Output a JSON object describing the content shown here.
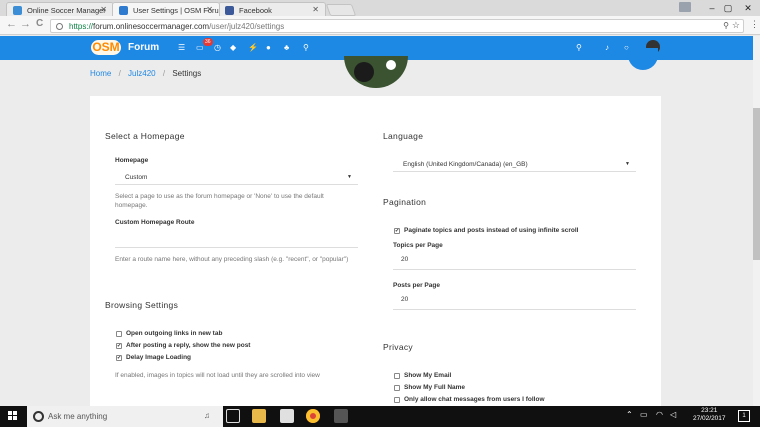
{
  "browser": {
    "tabs": [
      {
        "title": "Online Soccer Manager",
        "active": false
      },
      {
        "title": "User Settings | OSM Foru",
        "active": true
      },
      {
        "title": "Facebook",
        "active": false
      }
    ],
    "url_scheme": "https://",
    "url_host": "forum.onlinesoccermanager.com",
    "url_path": "/user/julz420/settings",
    "window_controls": {
      "minimize": "–",
      "maximize": "▢",
      "close": "✕"
    },
    "nav": {
      "back": "←",
      "forward": "→",
      "reload": "C"
    }
  },
  "site": {
    "logo": "OSM",
    "forum_label": "Forum",
    "notification_count": "36",
    "accent": "#1e88e5"
  },
  "breadcrumb": {
    "home": "Home",
    "user": "Julz420",
    "current": "Settings"
  },
  "left": {
    "homepage_section": "Select a Homepage",
    "homepage_label": "Homepage",
    "homepage_value": "Custom",
    "homepage_help": "Select a page to use as the forum homepage or 'None' to use the default homepage.",
    "route_label": "Custom Homepage Route",
    "route_value": "",
    "route_help": "Enter a route name here, without any preceding slash (e.g. \"recent\", or \"popular\")",
    "browsing_section": "Browsing Settings",
    "browsing_options": [
      {
        "label": "Open outgoing links in new tab",
        "checked": false
      },
      {
        "label": "After posting a reply, show the new post",
        "checked": true
      },
      {
        "label": "Delay Image Loading",
        "checked": true
      }
    ],
    "browsing_help": "If enabled, images in topics will not load until they are scrolled into view"
  },
  "right": {
    "language_section": "Language",
    "language_value": "English (United Kingdom/Canada) (en_GB)",
    "pagination_section": "Pagination",
    "paginate_label": "Paginate topics and posts instead of using infinite scroll",
    "paginate_checked": true,
    "topics_label": "Topics per Page",
    "topics_value": "20",
    "posts_label": "Posts per Page",
    "posts_value": "20",
    "privacy_section": "Privacy",
    "privacy_options": [
      {
        "label": "Show My Email",
        "checked": false
      },
      {
        "label": "Show My Full Name",
        "checked": false
      },
      {
        "label": "Only allow chat messages from users I follow",
        "checked": false
      }
    ]
  },
  "taskbar": {
    "search_placeholder": "Ask me anything",
    "time": "23:21",
    "date": "27/02/2017",
    "notification_count": "1"
  }
}
